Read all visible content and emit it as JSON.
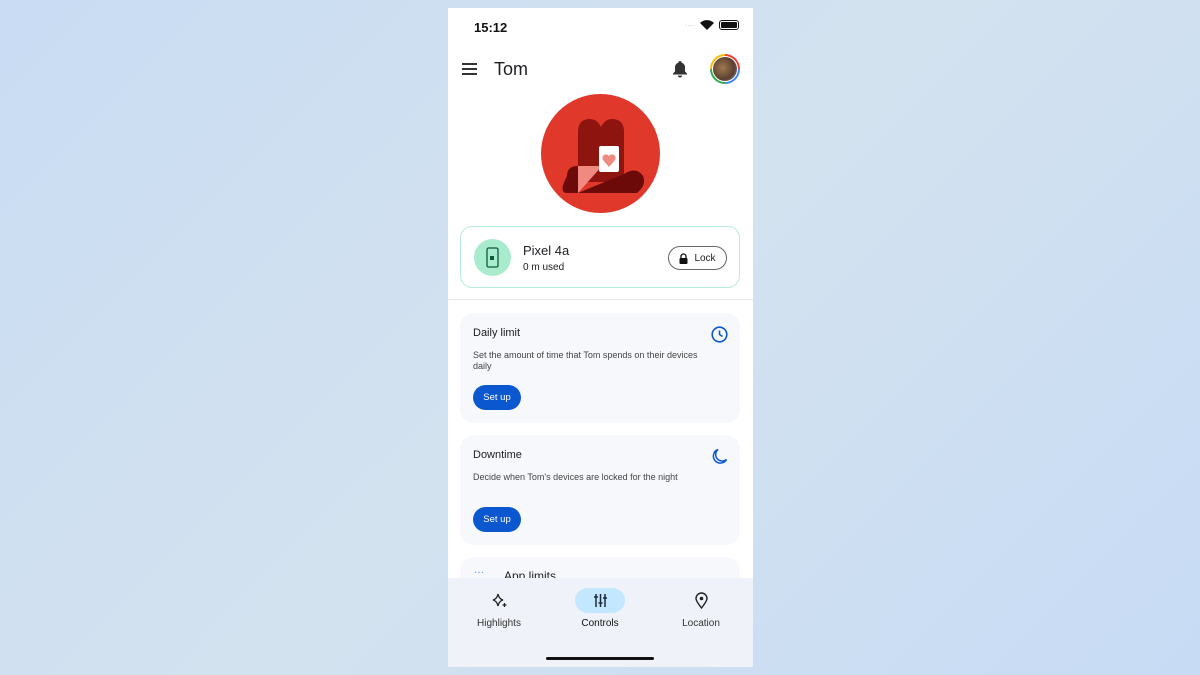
{
  "status": {
    "time": "15:12"
  },
  "header": {
    "title": "Tom"
  },
  "device": {
    "name": "Pixel 4a",
    "usage": "0 m used",
    "lock_label": "Lock"
  },
  "cards": [
    {
      "title": "Daily limit",
      "description": "Set the amount of time that Tom spends on their devices daily",
      "button": "Set up",
      "icon": "clock-icon"
    },
    {
      "title": "Downtime",
      "description": "Decide when Tom's devices are locked for the night",
      "button": "Set up",
      "icon": "moon-icon"
    },
    {
      "title": "App limits"
    }
  ],
  "nav": [
    {
      "label": "Highlights",
      "icon": "sparkle-icon"
    },
    {
      "label": "Controls",
      "icon": "sliders-icon",
      "active": true
    },
    {
      "label": "Location",
      "icon": "location-pin-icon"
    }
  ],
  "colors": {
    "accent": "#0b57d0",
    "hero": "#e0392b",
    "nav_active": "#c2e7ff"
  }
}
